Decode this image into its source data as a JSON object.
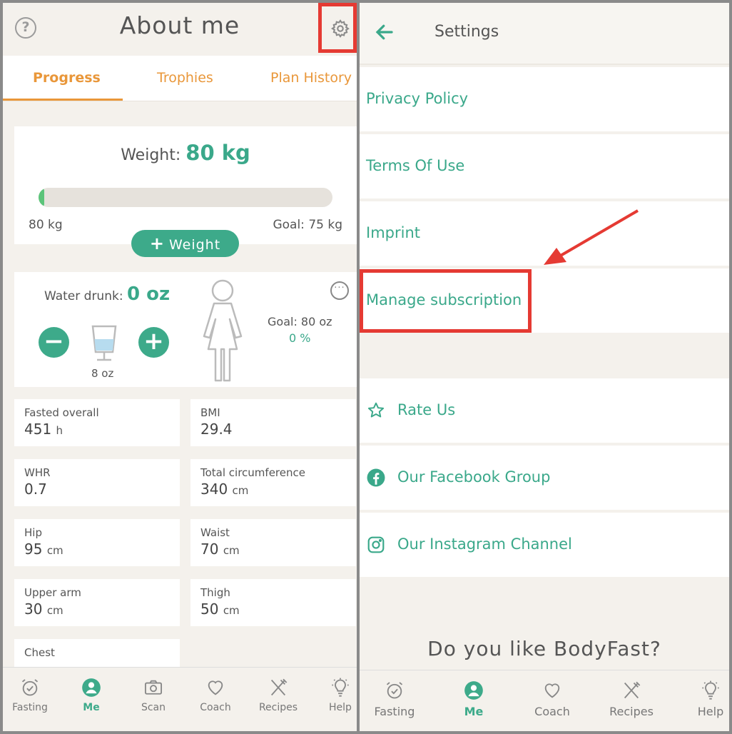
{
  "left": {
    "title": "About me",
    "tabs": [
      "Progress",
      "Trophies",
      "Plan History"
    ],
    "weight": {
      "label": "Weight: ",
      "value": "80 kg",
      "start": "80 kg",
      "goal": "Goal: 75 kg",
      "progress_fraction": 0.02,
      "add_button": "Weight",
      "add_symbol": "+"
    },
    "water": {
      "label": "Water drunk: ",
      "value": "0 oz",
      "glass_size": "8 oz",
      "goal": "Goal: 80 oz",
      "percent": "0 %",
      "minus": "−",
      "plus": "+",
      "more": "···"
    },
    "stats": [
      {
        "label": "Fasted overall",
        "value": "451",
        "unit": "h"
      },
      {
        "label": "BMI",
        "value": "29.4",
        "unit": ""
      },
      {
        "label": "WHR",
        "value": "0.7",
        "unit": ""
      },
      {
        "label": "Total circumference",
        "value": "340",
        "unit": "cm"
      },
      {
        "label": "Hip",
        "value": "95",
        "unit": "cm"
      },
      {
        "label": "Waist",
        "value": "70",
        "unit": "cm"
      },
      {
        "label": "Upper arm",
        "value": "30",
        "unit": "cm"
      },
      {
        "label": "Thigh",
        "value": "50",
        "unit": "cm"
      },
      {
        "label": "Chest",
        "value": "",
        "unit": ""
      }
    ],
    "help_symbol": "?",
    "nav": [
      "Fasting",
      "Me",
      "Scan",
      "Coach",
      "Recipes",
      "Help"
    ]
  },
  "right": {
    "title": "Settings",
    "items": [
      "Privacy Policy",
      "Terms Of Use",
      "Imprint",
      "Manage subscription"
    ],
    "social": [
      "Rate Us",
      "Our Facebook Group",
      "Our Instagram Channel"
    ],
    "question": "Do you like BodyFast?",
    "nav": [
      "Fasting",
      "Me",
      "Coach",
      "Recipes",
      "Help"
    ]
  },
  "colors": {
    "accent_green": "#3aa88a",
    "accent_orange": "#e9973a",
    "highlight_red": "#e53a33",
    "background": "#f4f1ec"
  },
  "icons": [
    "help-icon",
    "gear-icon",
    "glass-icon",
    "person-icon",
    "more-icon",
    "back-arrow-icon",
    "star-icon",
    "facebook-icon",
    "instagram-icon",
    "alarm-clock-icon",
    "user-icon",
    "camera-icon",
    "heart-icon",
    "fork-knife-icon",
    "lightbulb-icon",
    "annotation-arrow-icon"
  ]
}
